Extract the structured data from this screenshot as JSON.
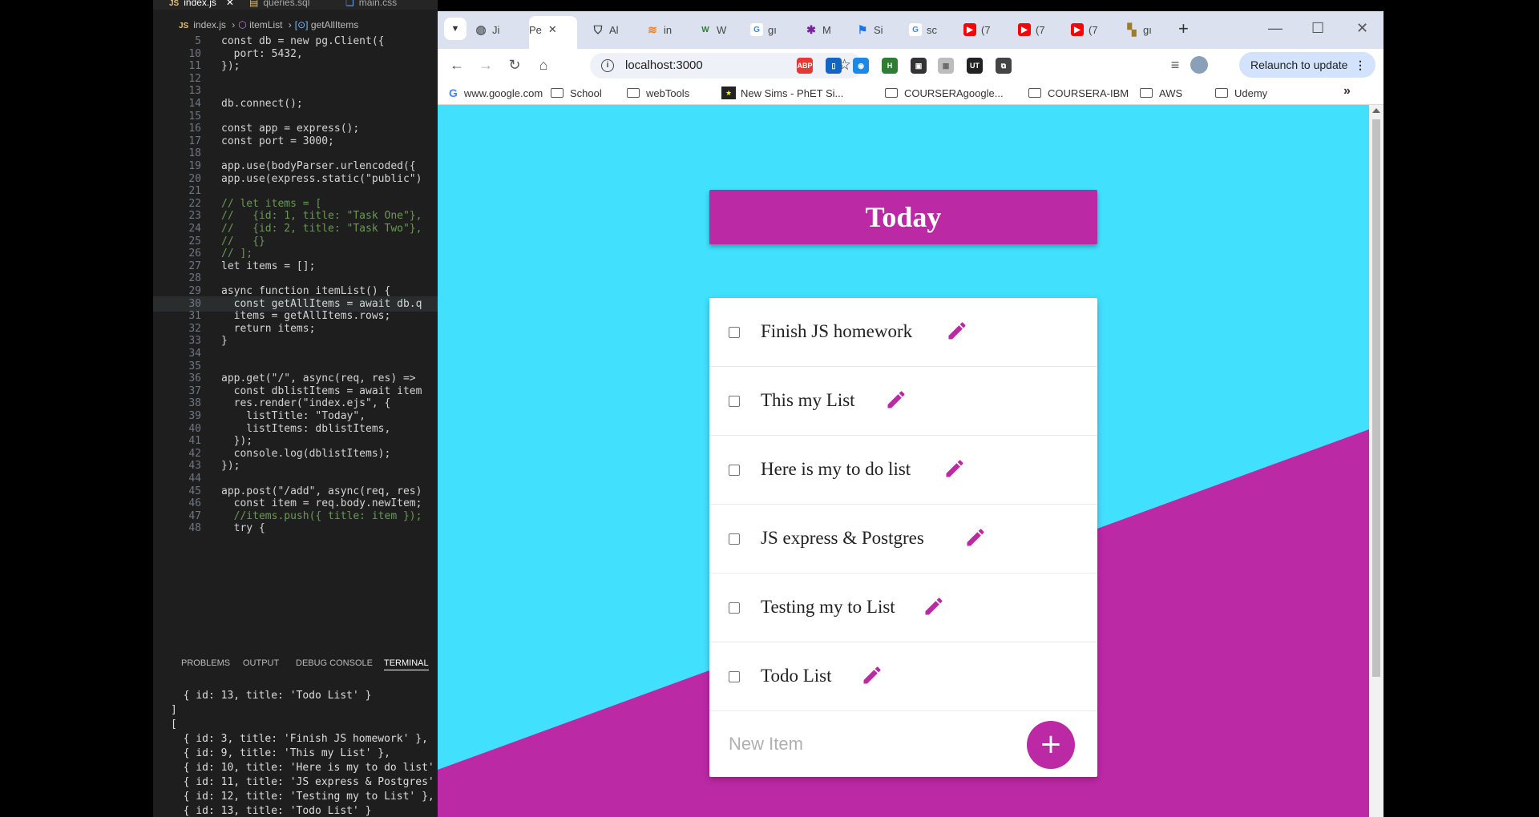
{
  "vscode": {
    "tabs": [
      "index.js",
      "queries.sql",
      "main.css"
    ],
    "breadcrumb": [
      "index.js",
      "itemList",
      "getAllItems"
    ],
    "code_lines": [
      {
        "n": "5",
        "t": "const db = new pg.Client({"
      },
      {
        "n": "10",
        "t": "  port: 5432,"
      },
      {
        "n": "11",
        "t": "});"
      },
      {
        "n": "12",
        "t": ""
      },
      {
        "n": "13",
        "t": ""
      },
      {
        "n": "14",
        "t": "db.connect();"
      },
      {
        "n": "15",
        "t": ""
      },
      {
        "n": "16",
        "t": "const app = express();"
      },
      {
        "n": "17",
        "t": "const port = 3000;"
      },
      {
        "n": "18",
        "t": ""
      },
      {
        "n": "19",
        "t": "app.use(bodyParser.urlencoded({"
      },
      {
        "n": "20",
        "t": "app.use(express.static(\"public\")"
      },
      {
        "n": "21",
        "t": ""
      },
      {
        "n": "22",
        "t": "// let items = ["
      },
      {
        "n": "23",
        "t": "//   {id: 1, title: \"Task One\"},"
      },
      {
        "n": "24",
        "t": "//   {id: 2, title: \"Task Two\"},"
      },
      {
        "n": "25",
        "t": "//   {}"
      },
      {
        "n": "26",
        "t": "// ];"
      },
      {
        "n": "27",
        "t": "let items = [];"
      },
      {
        "n": "28",
        "t": ""
      },
      {
        "n": "29",
        "t": "async function itemList() {"
      },
      {
        "n": "30",
        "t": "  const getAllItems = await db.q"
      },
      {
        "n": "31",
        "t": "  items = getAllItems.rows;"
      },
      {
        "n": "32",
        "t": "  return items;"
      },
      {
        "n": "33",
        "t": "}"
      },
      {
        "n": "34",
        "t": ""
      },
      {
        "n": "35",
        "t": ""
      },
      {
        "n": "36",
        "t": "app.get(\"/\", async(req, res) =>"
      },
      {
        "n": "37",
        "t": "  const dblistItems = await item"
      },
      {
        "n": "38",
        "t": "  res.render(\"index.ejs\", {"
      },
      {
        "n": "39",
        "t": "    listTitle: \"Today\","
      },
      {
        "n": "40",
        "t": "    listItems: dblistItems,"
      },
      {
        "n": "41",
        "t": "  });"
      },
      {
        "n": "42",
        "t": "  console.log(dblistItems);"
      },
      {
        "n": "43",
        "t": "});"
      },
      {
        "n": "44",
        "t": ""
      },
      {
        "n": "45",
        "t": "app.post(\"/add\", async(req, res)"
      },
      {
        "n": "46",
        "t": "  const item = req.body.newItem;"
      },
      {
        "n": "47",
        "t": "  //items.push({ title: item });"
      },
      {
        "n": "48",
        "t": "  try {"
      }
    ],
    "panel_tabs": [
      "PROBLEMS",
      "OUTPUT",
      "DEBUG CONSOLE",
      "TERMINAL"
    ],
    "terminal_lines": [
      "  { id: 13, title: 'Todo List' }",
      "]",
      "[",
      "  { id: 3, title: 'Finish JS homework' },",
      "  { id: 9, title: 'This my List' },",
      "  { id: 10, title: 'Here is my to do list' },",
      "  { id: 11, title: 'JS express & Postgres' },",
      "  { id: 12, title: 'Testing my to List' },",
      "  { id: 13, title: 'Todo List' }"
    ]
  },
  "browser": {
    "tabs": [
      {
        "label": "Ji",
        "icon": "globe-icon",
        "color": "#5f6368"
      },
      {
        "label": "Pe",
        "icon": "page-icon",
        "color": "#ffffff"
      },
      {
        "label": "Al",
        "icon": "shield-icon",
        "color": "#3c4043"
      },
      {
        "label": "in",
        "icon": "stack-icon",
        "color": "#f48024"
      },
      {
        "label": "W",
        "icon": "w-icon",
        "color": "#2e7d32"
      },
      {
        "label": "gı",
        "icon": "google-icon",
        "color": "#4285f4"
      },
      {
        "label": "M",
        "icon": "puzzle-icon",
        "color": "#7b1fa2"
      },
      {
        "label": "Si",
        "icon": "flag-icon",
        "color": "#1a73e8"
      },
      {
        "label": "sc",
        "icon": "google-icon",
        "color": "#4285f4"
      },
      {
        "label": "(7",
        "icon": "youtube-icon",
        "color": "#ff0000"
      },
      {
        "label": "(7",
        "icon": "youtube-icon",
        "color": "#ff0000"
      },
      {
        "label": "(7",
        "icon": "youtube-icon",
        "color": "#ff0000"
      },
      {
        "label": "gı",
        "icon": "grid-icon",
        "color": "#9e7b2a"
      }
    ],
    "new_tab": "+",
    "url": "localhost:3000",
    "relaunch": "Relaunch to update",
    "bookmarks": [
      "www.google.com",
      "School",
      "webTools",
      "New Sims - PhET Si...",
      "COURSERAgoogle...",
      "COURSERA-IBM",
      "AWS",
      "Udemy"
    ],
    "extensions": [
      {
        "name": "adblock-icon",
        "label": "ABP",
        "color": "#e53935"
      },
      {
        "name": "clipboard-icon",
        "label": "▯",
        "color": "#1565c0"
      },
      {
        "name": "circle-ext-icon",
        "label": "◉",
        "color": "#1e88e5"
      },
      {
        "name": "html-ext-icon",
        "label": "H",
        "color": "#2e7d32"
      },
      {
        "name": "screenshot-icon",
        "label": "▣",
        "color": "#333333"
      },
      {
        "name": "grid-ext-icon",
        "label": "▦",
        "color": "#bdbdbd"
      },
      {
        "name": "ut-ext-icon",
        "label": "UT",
        "color": "#222222"
      },
      {
        "name": "puzzle-icon",
        "label": "⧉",
        "color": "#444444"
      }
    ]
  },
  "app": {
    "heading": "Today",
    "items": [
      "Finish JS homework",
      "This my List",
      "Here is my to do list",
      "JS express & Postgres",
      "Testing my to List",
      "Todo List"
    ],
    "new_item_placeholder": "New Item",
    "add_label": "+",
    "colors": {
      "primary": "#bb29a5",
      "background": "#41e0fd"
    }
  }
}
